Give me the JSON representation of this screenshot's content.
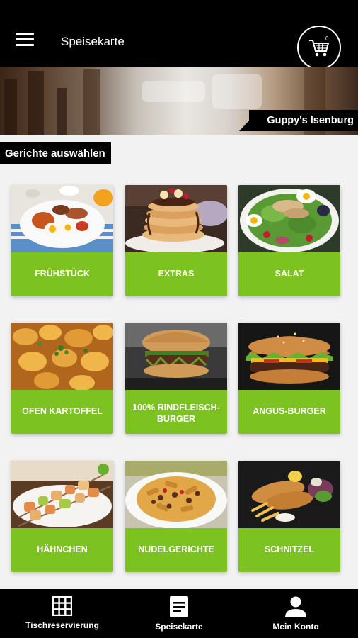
{
  "header": {
    "title": "Speisekarte",
    "cart_count": "0",
    "menu_icon": "hamburger-icon",
    "cart_icon": "shopping-cart-icon"
  },
  "banner": {
    "restaurant_name": "Guppy's Isenburg"
  },
  "section": {
    "title": "Gerichte auswählen"
  },
  "categories": [
    {
      "label": "FRÜHSTÜCK"
    },
    {
      "label": "EXTRAS"
    },
    {
      "label": "SALAT"
    },
    {
      "label": "OFEN KARTOFFEL"
    },
    {
      "label": "100% RINDFLEISCH-BURGER"
    },
    {
      "label": "ANGUS-BURGER"
    },
    {
      "label": "HÄHNCHEN"
    },
    {
      "label": "NUDELGERICHTE"
    },
    {
      "label": "SCHNITZEL"
    }
  ],
  "tabs": [
    {
      "label": "Tischreservierung",
      "icon": "grid-icon"
    },
    {
      "label": "Speisekarte",
      "icon": "document-icon"
    },
    {
      "label": "Mein Konto",
      "icon": "person-icon"
    }
  ],
  "colors": {
    "accent": "#7cc221",
    "bar": "#000000",
    "background": "#f2f2f2"
  }
}
